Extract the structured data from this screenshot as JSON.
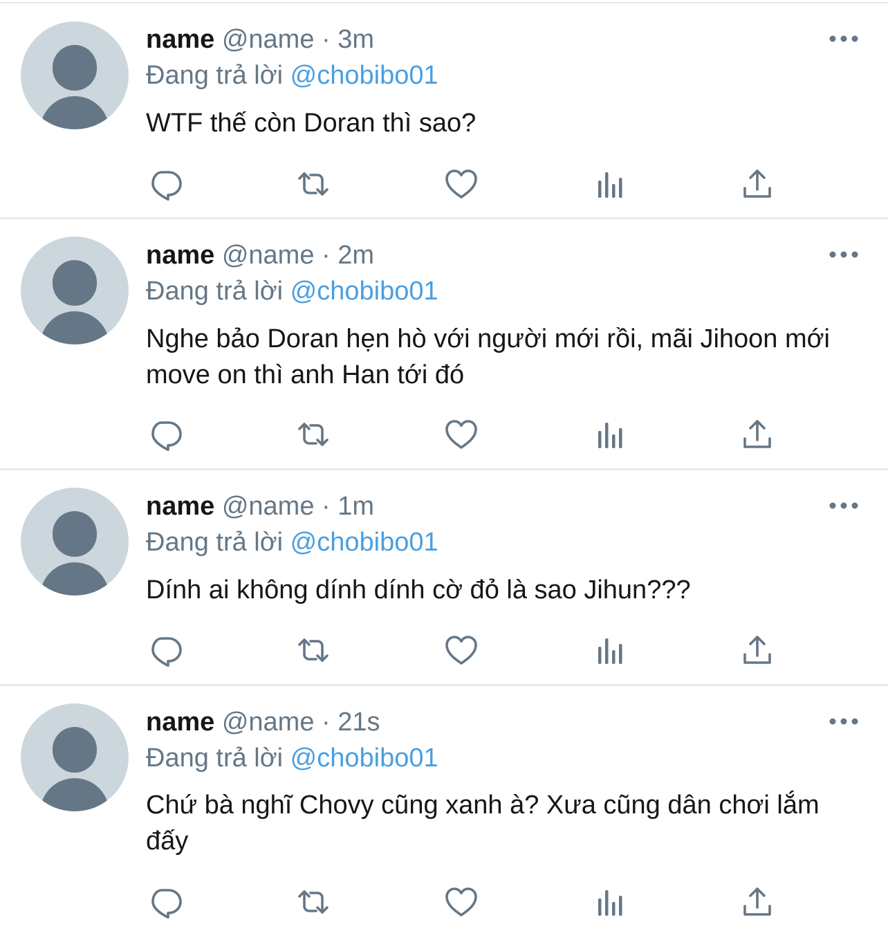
{
  "colors": {
    "background": "#ffffff",
    "divider": "#e6e9ec",
    "avatar_bg": "#ccd6dd",
    "avatar_fg": "#657786",
    "secondary_text": "#657786",
    "link": "#4a9fe0",
    "primary_text": "#14171a"
  },
  "icons": {
    "more": "more-horizontal-icon",
    "reply": "reply-icon",
    "retweet": "retweet-icon",
    "like": "heart-icon",
    "views": "analytics-icon",
    "share": "share-icon"
  },
  "tweets": [
    {
      "name": "name",
      "handle": "@name",
      "separator": "·",
      "time": "3m",
      "reply_prefix": "Đang trả lời",
      "reply_to": "@chobibo01",
      "text": "WTF thế còn Doran thì sao?"
    },
    {
      "name": "name",
      "handle": "@name",
      "separator": "·",
      "time": "2m",
      "reply_prefix": "Đang trả lời",
      "reply_to": "@chobibo01",
      "text": "Nghe bảo Doran hẹn hò với người mới rồi, mãi Jihoon mới move on thì anh Han tới đó"
    },
    {
      "name": "name",
      "handle": "@name",
      "separator": "·",
      "time": "1m",
      "reply_prefix": "Đang trả lời",
      "reply_to": "@chobibo01",
      "text": "Dính ai không dính dính cờ đỏ là sao Jihun???"
    },
    {
      "name": "name",
      "handle": "@name",
      "separator": "·",
      "time": "21s",
      "reply_prefix": "Đang trả lời",
      "reply_to": "@chobibo01",
      "text": "Chứ bà nghĩ Chovy cũng xanh à? Xưa cũng dân chơi lắm đấy"
    }
  ]
}
